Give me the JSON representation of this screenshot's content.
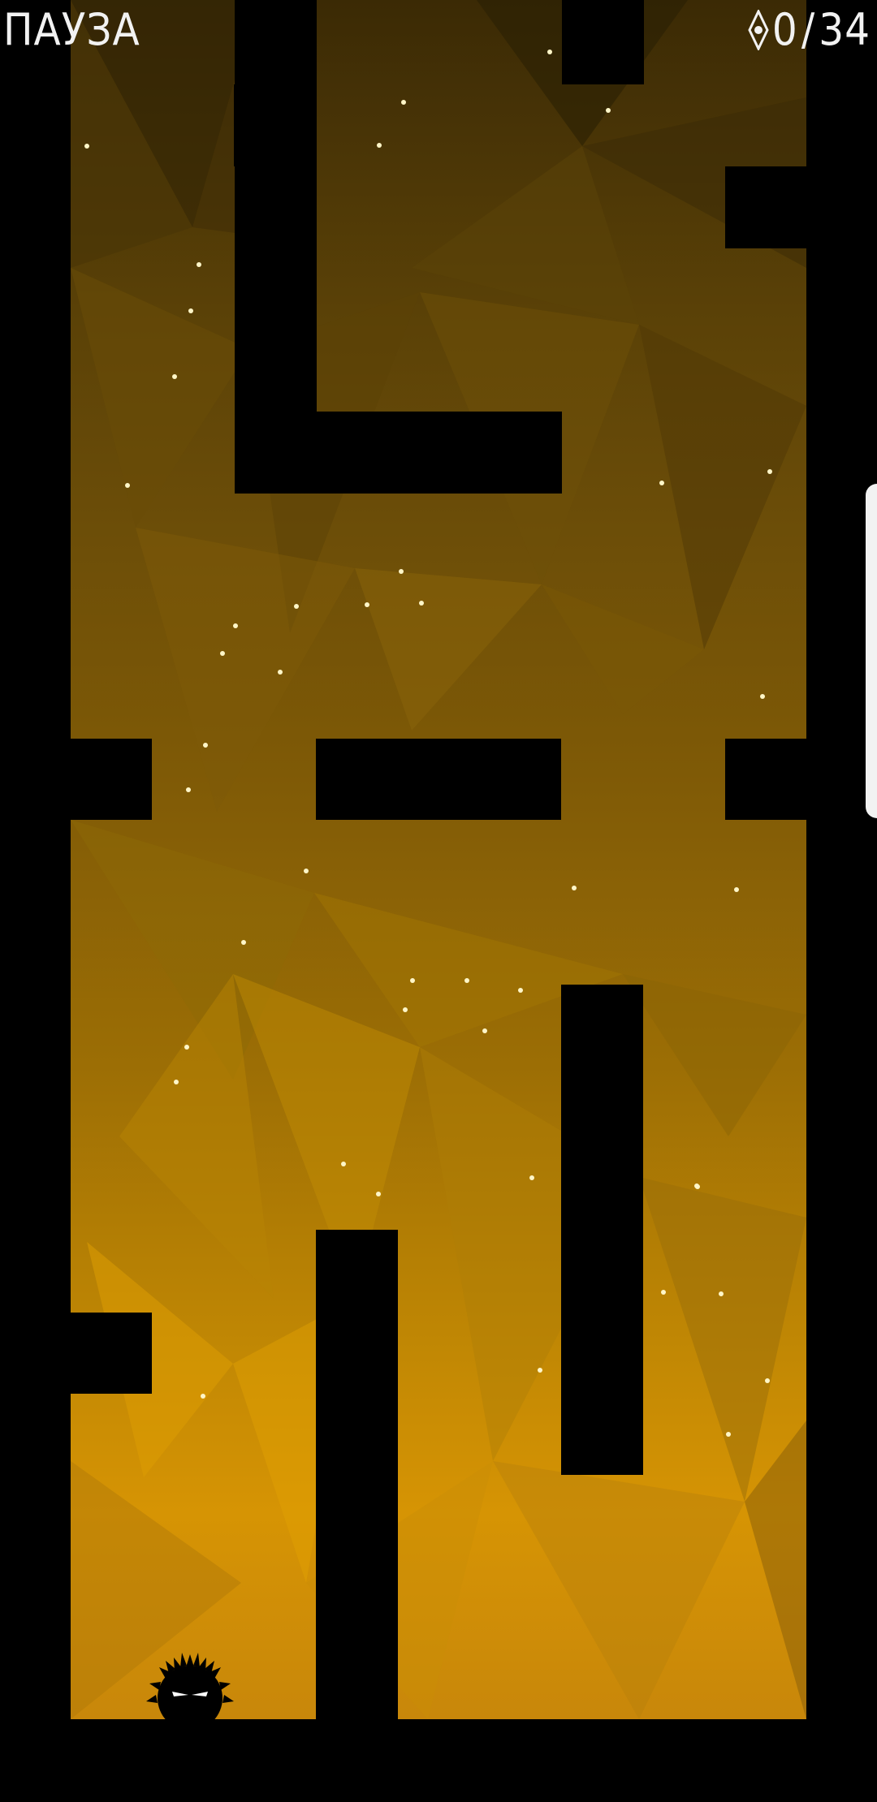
{
  "hud": {
    "pause_label": "ПАУЗА",
    "collected": "0",
    "separator": "/",
    "total": "34",
    "gem_icon": "gem-icon"
  },
  "colors": {
    "wall": "#000000",
    "background_top": "#3b2a05",
    "background_bottom": "#d69404",
    "sparkle": "#fff6c8",
    "hud_text": "#f2f2f2"
  },
  "player": {
    "name": "fuzzy-black-creature"
  }
}
